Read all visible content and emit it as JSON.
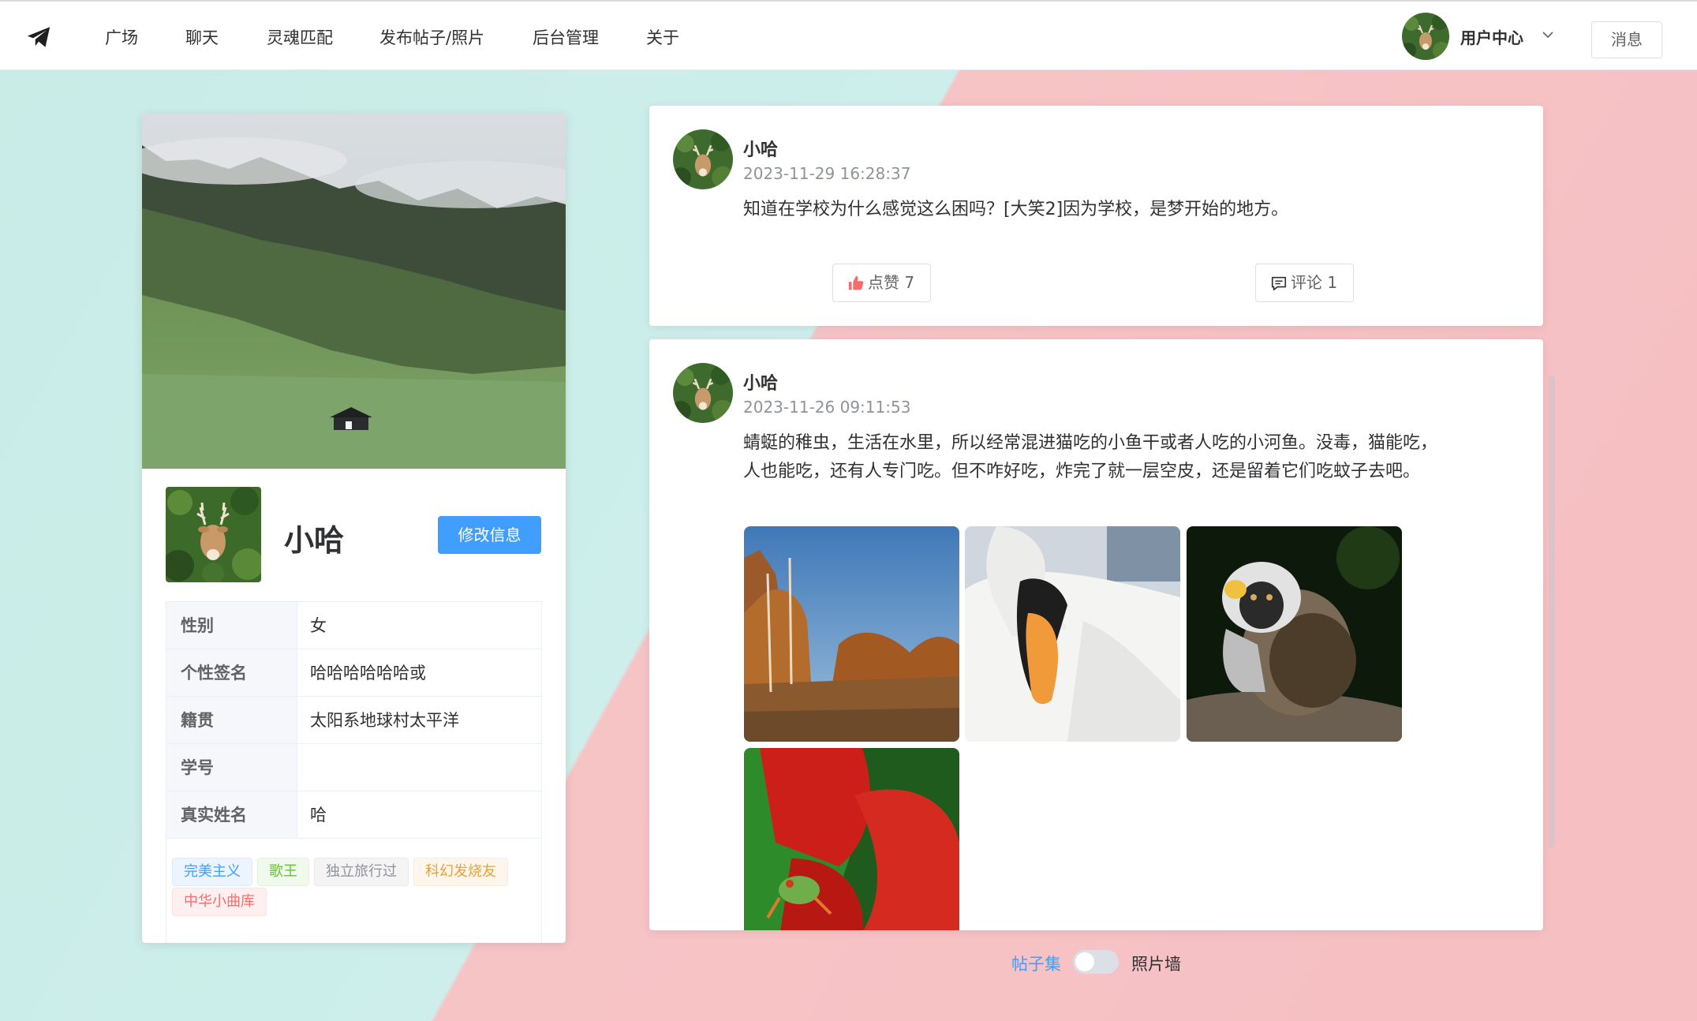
{
  "nav": {
    "items": [
      "广场",
      "聊天",
      "灵魂匹配",
      "发布帖子/照片",
      "后台管理",
      "关于"
    ],
    "user_center": "用户中心",
    "message_button": "消息"
  },
  "profile": {
    "name": "小哈",
    "edit_button": "修改信息",
    "info": [
      {
        "label": "性别",
        "value": "女"
      },
      {
        "label": "个性签名",
        "value": "哈哈哈哈哈哈或"
      },
      {
        "label": "籍贯",
        "value": "太阳系地球村太平洋"
      },
      {
        "label": "学号",
        "value": ""
      },
      {
        "label": "真实姓名",
        "value": "哈"
      }
    ],
    "tags": [
      {
        "text": "完美主义",
        "color": "#409eff",
        "bg": "#ecf5ff",
        "border": "#d9ecff"
      },
      {
        "text": "歌王",
        "color": "#67c23a",
        "bg": "#f0f9eb",
        "border": "#e1f3d8"
      },
      {
        "text": "独立旅行过",
        "color": "#909399",
        "bg": "#f4f4f5",
        "border": "#e9e9eb"
      },
      {
        "text": "科幻发烧友",
        "color": "#e6a23c",
        "bg": "#fdf6ec",
        "border": "#faecd8"
      },
      {
        "text": "中华小曲库",
        "color": "#f56c6c",
        "bg": "#fef0f0",
        "border": "#fde2e2"
      }
    ]
  },
  "posts": [
    {
      "author": "小哈",
      "time": "2023-11-29 16:28:37",
      "content": "知道在学校为什么感觉这么困吗？[大笑2]因为学校，是梦开始的地方。",
      "like_label": "点赞 7",
      "comment_label": "评论 1"
    },
    {
      "author": "小哈",
      "time": "2023-11-26 09:11:53",
      "content": "蜻蜓的稚虫，生活在水里，所以经常混进猫吃的小鱼干或者人吃的小河鱼。没毒，猫能吃，人也能吃，还有人专门吃。但不咋好吃，炸完了就一层空皮，还是留着它们吃蚊子去吧。"
    }
  ],
  "view_toggle": {
    "left_label": "帖子集",
    "right_label": "照片墙",
    "checked": false
  },
  "colors": {
    "primary": "#409eff",
    "like_icon": "#f56c6c"
  },
  "icons": {
    "logo": "paper-plane-icon",
    "like": "thumbs-up-icon",
    "comment": "comment-icon",
    "dropdown": "chevron-down-icon"
  }
}
